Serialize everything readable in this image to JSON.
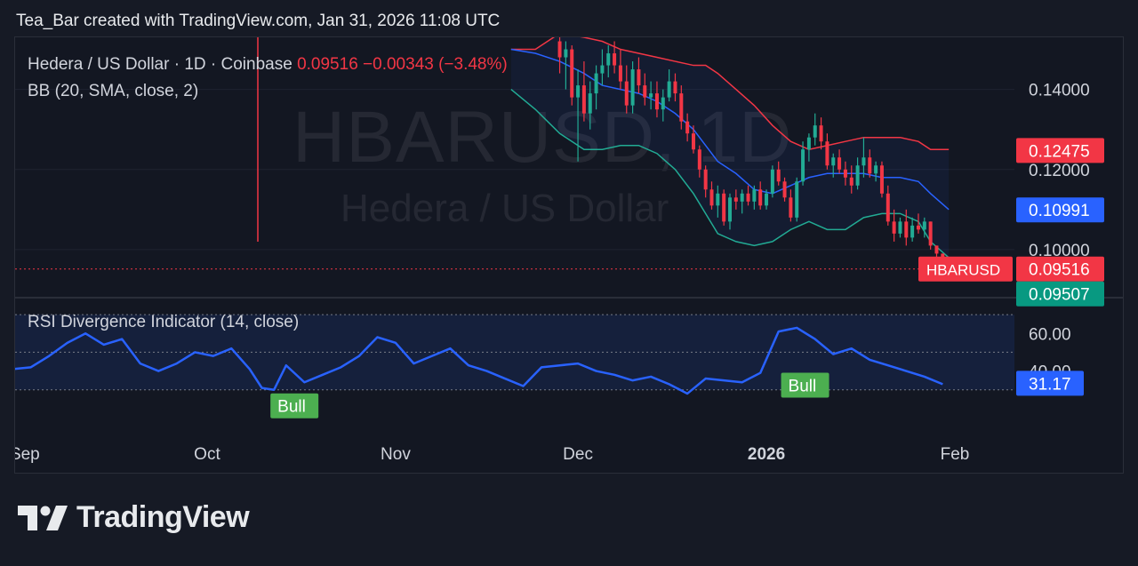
{
  "header": {
    "text": "Tea_Bar created with TradingView.com, Jan 31, 2026 11:08 UTC"
  },
  "legend": {
    "symbol": "Hedera / US Dollar · 1D · Coinbase",
    "close": "0.09516",
    "change": "−0.00343 (−3.48%)",
    "bb_label": "BB (20, SMA, close, 2)",
    "rsi_label": "RSI Divergence Indicator (14, close)"
  },
  "watermark": {
    "ticker": "HBARUSD, 1D",
    "name": "Hedera / US Dollar"
  },
  "footer": {
    "brand": "TradingView"
  },
  "colors": {
    "up": "#22ab94",
    "down": "#f23645",
    "basis": "#2962ff",
    "rsi": "#2962ff",
    "bull": "#4caf50",
    "background": "#131722"
  },
  "chart_data": [
    {
      "type": "candlestick",
      "ylim": [
        0.088,
        0.153
      ],
      "x_ticks": [
        "Sep",
        "Oct",
        "Nov",
        "Dec",
        "2026",
        "Feb"
      ],
      "y_ticks": [
        "0.14000",
        "0.12000",
        "0.10000"
      ],
      "price_badges": [
        {
          "label": "0.12475",
          "value": 0.12475,
          "color": "#f23645"
        },
        {
          "label": "0.10991",
          "value": 0.10991,
          "color": "#2962ff"
        },
        {
          "label": "0.09516",
          "value": 0.09516,
          "color": "#f23645",
          "symbol": "HBARUSD"
        },
        {
          "label": "0.09507",
          "value": 0.09507,
          "color": "#089981"
        }
      ],
      "last_price": 0.09516,
      "candles": [
        {
          "date": "2025-11-28",
          "o": 0.152,
          "h": 0.156,
          "l": 0.144,
          "c": 0.148
        },
        {
          "date": "2025-11-29",
          "o": 0.148,
          "h": 0.152,
          "l": 0.14,
          "c": 0.15
        },
        {
          "date": "2025-11-30",
          "o": 0.15,
          "h": 0.151,
          "l": 0.136,
          "c": 0.138
        },
        {
          "date": "2025-12-01",
          "o": 0.138,
          "h": 0.145,
          "l": 0.122,
          "c": 0.141
        },
        {
          "date": "2025-12-02",
          "o": 0.141,
          "h": 0.147,
          "l": 0.132,
          "c": 0.134
        },
        {
          "date": "2025-12-03",
          "o": 0.134,
          "h": 0.142,
          "l": 0.13,
          "c": 0.139
        },
        {
          "date": "2025-12-04",
          "o": 0.139,
          "h": 0.146,
          "l": 0.135,
          "c": 0.144
        },
        {
          "date": "2025-12-05",
          "o": 0.144,
          "h": 0.15,
          "l": 0.141,
          "c": 0.146
        },
        {
          "date": "2025-12-06",
          "o": 0.146,
          "h": 0.151,
          "l": 0.143,
          "c": 0.149
        },
        {
          "date": "2025-12-07",
          "o": 0.149,
          "h": 0.152,
          "l": 0.144,
          "c": 0.146
        },
        {
          "date": "2025-12-08",
          "o": 0.146,
          "h": 0.15,
          "l": 0.14,
          "c": 0.142
        },
        {
          "date": "2025-12-09",
          "o": 0.142,
          "h": 0.146,
          "l": 0.134,
          "c": 0.136
        },
        {
          "date": "2025-12-10",
          "o": 0.136,
          "h": 0.147,
          "l": 0.134,
          "c": 0.145
        },
        {
          "date": "2025-12-11",
          "o": 0.145,
          "h": 0.148,
          "l": 0.139,
          "c": 0.141
        },
        {
          "date": "2025-12-12",
          "o": 0.141,
          "h": 0.144,
          "l": 0.136,
          "c": 0.138
        },
        {
          "date": "2025-12-13",
          "o": 0.138,
          "h": 0.142,
          "l": 0.135,
          "c": 0.139
        },
        {
          "date": "2025-12-14",
          "o": 0.139,
          "h": 0.142,
          "l": 0.133,
          "c": 0.135
        },
        {
          "date": "2025-12-15",
          "o": 0.135,
          "h": 0.14,
          "l": 0.132,
          "c": 0.138
        },
        {
          "date": "2025-12-16",
          "o": 0.138,
          "h": 0.145,
          "l": 0.137,
          "c": 0.142
        },
        {
          "date": "2025-12-17",
          "o": 0.142,
          "h": 0.144,
          "l": 0.137,
          "c": 0.139
        },
        {
          "date": "2025-12-18",
          "o": 0.139,
          "h": 0.141,
          "l": 0.13,
          "c": 0.132
        },
        {
          "date": "2025-12-19",
          "o": 0.132,
          "h": 0.134,
          "l": 0.127,
          "c": 0.129
        },
        {
          "date": "2025-12-20",
          "o": 0.129,
          "h": 0.131,
          "l": 0.124,
          "c": 0.125
        },
        {
          "date": "2025-12-21",
          "o": 0.125,
          "h": 0.126,
          "l": 0.118,
          "c": 0.12
        },
        {
          "date": "2025-12-22",
          "o": 0.12,
          "h": 0.121,
          "l": 0.113,
          "c": 0.115
        },
        {
          "date": "2025-12-23",
          "o": 0.115,
          "h": 0.117,
          "l": 0.11,
          "c": 0.111
        },
        {
          "date": "2025-12-24",
          "o": 0.111,
          "h": 0.116,
          "l": 0.108,
          "c": 0.114
        },
        {
          "date": "2025-12-25",
          "o": 0.114,
          "h": 0.115,
          "l": 0.106,
          "c": 0.107
        },
        {
          "date": "2025-12-26",
          "o": 0.107,
          "h": 0.114,
          "l": 0.105,
          "c": 0.113
        },
        {
          "date": "2025-12-27",
          "o": 0.113,
          "h": 0.115,
          "l": 0.11,
          "c": 0.112
        },
        {
          "date": "2025-12-28",
          "o": 0.112,
          "h": 0.115,
          "l": 0.109,
          "c": 0.114
        },
        {
          "date": "2025-12-29",
          "o": 0.114,
          "h": 0.116,
          "l": 0.111,
          "c": 0.112
        },
        {
          "date": "2025-12-30",
          "o": 0.112,
          "h": 0.116,
          "l": 0.11,
          "c": 0.115
        },
        {
          "date": "2025-12-31",
          "o": 0.115,
          "h": 0.117,
          "l": 0.11,
          "c": 0.111
        },
        {
          "date": "2026-01-01",
          "o": 0.111,
          "h": 0.115,
          "l": 0.11,
          "c": 0.114
        },
        {
          "date": "2026-01-02",
          "o": 0.114,
          "h": 0.121,
          "l": 0.113,
          "c": 0.12
        },
        {
          "date": "2026-01-03",
          "o": 0.12,
          "h": 0.122,
          "l": 0.116,
          "c": 0.117
        },
        {
          "date": "2026-01-04",
          "o": 0.117,
          "h": 0.118,
          "l": 0.112,
          "c": 0.113
        },
        {
          "date": "2026-01-05",
          "o": 0.113,
          "h": 0.115,
          "l": 0.107,
          "c": 0.108
        },
        {
          "date": "2026-01-06",
          "o": 0.108,
          "h": 0.118,
          "l": 0.107,
          "c": 0.117
        },
        {
          "date": "2026-01-07",
          "o": 0.117,
          "h": 0.127,
          "l": 0.116,
          "c": 0.125
        },
        {
          "date": "2026-01-08",
          "o": 0.125,
          "h": 0.129,
          "l": 0.122,
          "c": 0.128
        },
        {
          "date": "2026-01-09",
          "o": 0.128,
          "h": 0.134,
          "l": 0.126,
          "c": 0.131
        },
        {
          "date": "2026-01-10",
          "o": 0.131,
          "h": 0.133,
          "l": 0.125,
          "c": 0.127
        },
        {
          "date": "2026-01-11",
          "o": 0.127,
          "h": 0.129,
          "l": 0.12,
          "c": 0.121
        },
        {
          "date": "2026-01-12",
          "o": 0.121,
          "h": 0.124,
          "l": 0.118,
          "c": 0.123
        },
        {
          "date": "2026-01-13",
          "o": 0.123,
          "h": 0.125,
          "l": 0.119,
          "c": 0.12
        },
        {
          "date": "2026-01-14",
          "o": 0.12,
          "h": 0.122,
          "l": 0.116,
          "c": 0.118
        },
        {
          "date": "2026-01-15",
          "o": 0.118,
          "h": 0.121,
          "l": 0.114,
          "c": 0.116
        },
        {
          "date": "2026-01-16",
          "o": 0.116,
          "h": 0.123,
          "l": 0.115,
          "c": 0.121
        },
        {
          "date": "2026-01-17",
          "o": 0.121,
          "h": 0.128,
          "l": 0.118,
          "c": 0.123
        },
        {
          "date": "2026-01-18",
          "o": 0.123,
          "h": 0.125,
          "l": 0.118,
          "c": 0.119
        },
        {
          "date": "2026-01-19",
          "o": 0.119,
          "h": 0.122,
          "l": 0.117,
          "c": 0.121
        },
        {
          "date": "2026-01-20",
          "o": 0.121,
          "h": 0.122,
          "l": 0.113,
          "c": 0.114
        },
        {
          "date": "2026-01-21",
          "o": 0.114,
          "h": 0.116,
          "l": 0.106,
          "c": 0.107
        },
        {
          "date": "2026-01-22",
          "o": 0.107,
          "h": 0.11,
          "l": 0.102,
          "c": 0.104
        },
        {
          "date": "2026-01-23",
          "o": 0.104,
          "h": 0.108,
          "l": 0.103,
          "c": 0.107
        },
        {
          "date": "2026-01-24",
          "o": 0.107,
          "h": 0.11,
          "l": 0.101,
          "c": 0.103
        },
        {
          "date": "2026-01-25",
          "o": 0.103,
          "h": 0.108,
          "l": 0.102,
          "c": 0.106
        },
        {
          "date": "2026-01-26",
          "o": 0.106,
          "h": 0.109,
          "l": 0.104,
          "c": 0.105
        },
        {
          "date": "2026-01-27",
          "o": 0.105,
          "h": 0.108,
          "l": 0.103,
          "c": 0.107
        },
        {
          "date": "2026-01-28",
          "o": 0.107,
          "h": 0.107,
          "l": 0.1,
          "c": 0.101
        },
        {
          "date": "2026-01-29",
          "o": 0.101,
          "h": 0.101,
          "l": 0.098,
          "c": 0.099
        },
        {
          "date": "2026-01-30",
          "o": 0.099,
          "h": 0.099,
          "l": 0.095,
          "c": 0.0955
        }
      ],
      "bollinger": {
        "upper": [
          0.15,
          0.15,
          0.154,
          0.153,
          0.152,
          0.15,
          0.149,
          0.148,
          0.147,
          0.146,
          0.146,
          0.144,
          0.14,
          0.136,
          0.131,
          0.127,
          0.125,
          0.126,
          0.127,
          0.128,
          0.128,
          0.128,
          0.127,
          0.125,
          0.125
        ],
        "basis": [
          0.15,
          0.149,
          0.147,
          0.144,
          0.141,
          0.14,
          0.139,
          0.137,
          0.134,
          0.13,
          0.126,
          0.122,
          0.119,
          0.115,
          0.114,
          0.116,
          0.118,
          0.119,
          0.119,
          0.119,
          0.118,
          0.118,
          0.117,
          0.114,
          0.11
        ],
        "lower": [
          0.14,
          0.135,
          0.129,
          0.125,
          0.125,
          0.126,
          0.126,
          0.124,
          0.12,
          0.114,
          0.109,
          0.104,
          0.102,
          0.101,
          0.102,
          0.105,
          0.107,
          0.105,
          0.105,
          0.108,
          0.109,
          0.109,
          0.107,
          0.102,
          0.098
        ]
      },
      "bb_dates": [
        "2025-11-20",
        "2025-11-24",
        "2025-11-28",
        "2025-12-02",
        "2025-12-05",
        "2025-12-08",
        "2025-12-11",
        "2025-12-14",
        "2025-12-17",
        "2025-12-20",
        "2025-12-22",
        "2025-12-24",
        "2025-12-27",
        "2025-12-30",
        "2026-01-02",
        "2026-01-05",
        "2026-01-08",
        "2026-01-11",
        "2026-01-14",
        "2026-01-17",
        "2026-01-20",
        "2026-01-23",
        "2026-01-26",
        "2026-01-28",
        "2026-01-31"
      ]
    },
    {
      "type": "line",
      "name": "RSI",
      "ylim": [
        19,
        71
      ],
      "y_ticks": [
        "60.00",
        "40.00"
      ],
      "last_value_label": "31.17",
      "x": [
        "2025-08-30",
        "2025-09-02",
        "2025-09-05",
        "2025-09-08",
        "2025-09-11",
        "2025-09-14",
        "2025-09-17",
        "2025-09-20",
        "2025-09-23",
        "2025-09-26",
        "2025-09-29",
        "2025-10-02",
        "2025-10-05",
        "2025-10-08",
        "2025-10-10",
        "2025-10-12",
        "2025-10-14",
        "2025-10-17",
        "2025-10-20",
        "2025-10-23",
        "2025-10-26",
        "2025-10-29",
        "2025-11-01",
        "2025-11-04",
        "2025-11-07",
        "2025-11-10",
        "2025-11-13",
        "2025-11-16",
        "2025-11-19",
        "2025-11-22",
        "2025-11-25",
        "2025-11-28",
        "2025-12-01",
        "2025-12-04",
        "2025-12-07",
        "2025-12-10",
        "2025-12-13",
        "2025-12-16",
        "2025-12-19",
        "2025-12-22",
        "2025-12-25",
        "2025-12-28",
        "2025-12-31",
        "2026-01-03",
        "2026-01-06",
        "2026-01-09",
        "2026-01-12",
        "2026-01-15",
        "2026-01-18",
        "2026-01-21",
        "2026-01-24",
        "2026-01-27",
        "2026-01-30"
      ],
      "values": [
        41,
        42,
        48,
        55,
        60,
        54,
        57,
        44,
        40,
        44,
        50,
        48,
        52,
        41,
        31,
        30,
        43,
        34,
        38,
        42,
        48,
        58,
        55,
        44,
        48,
        52,
        43,
        40,
        36,
        32,
        42,
        43,
        44,
        40,
        38,
        35,
        37,
        33,
        28,
        36,
        35,
        34,
        39,
        61,
        63,
        57,
        49,
        52,
        46,
        43,
        40,
        37,
        33
      ],
      "signals": [
        {
          "date": "2025-10-12",
          "label": "Bull"
        },
        {
          "date": "2026-01-04",
          "label": "Bull"
        }
      ]
    }
  ]
}
